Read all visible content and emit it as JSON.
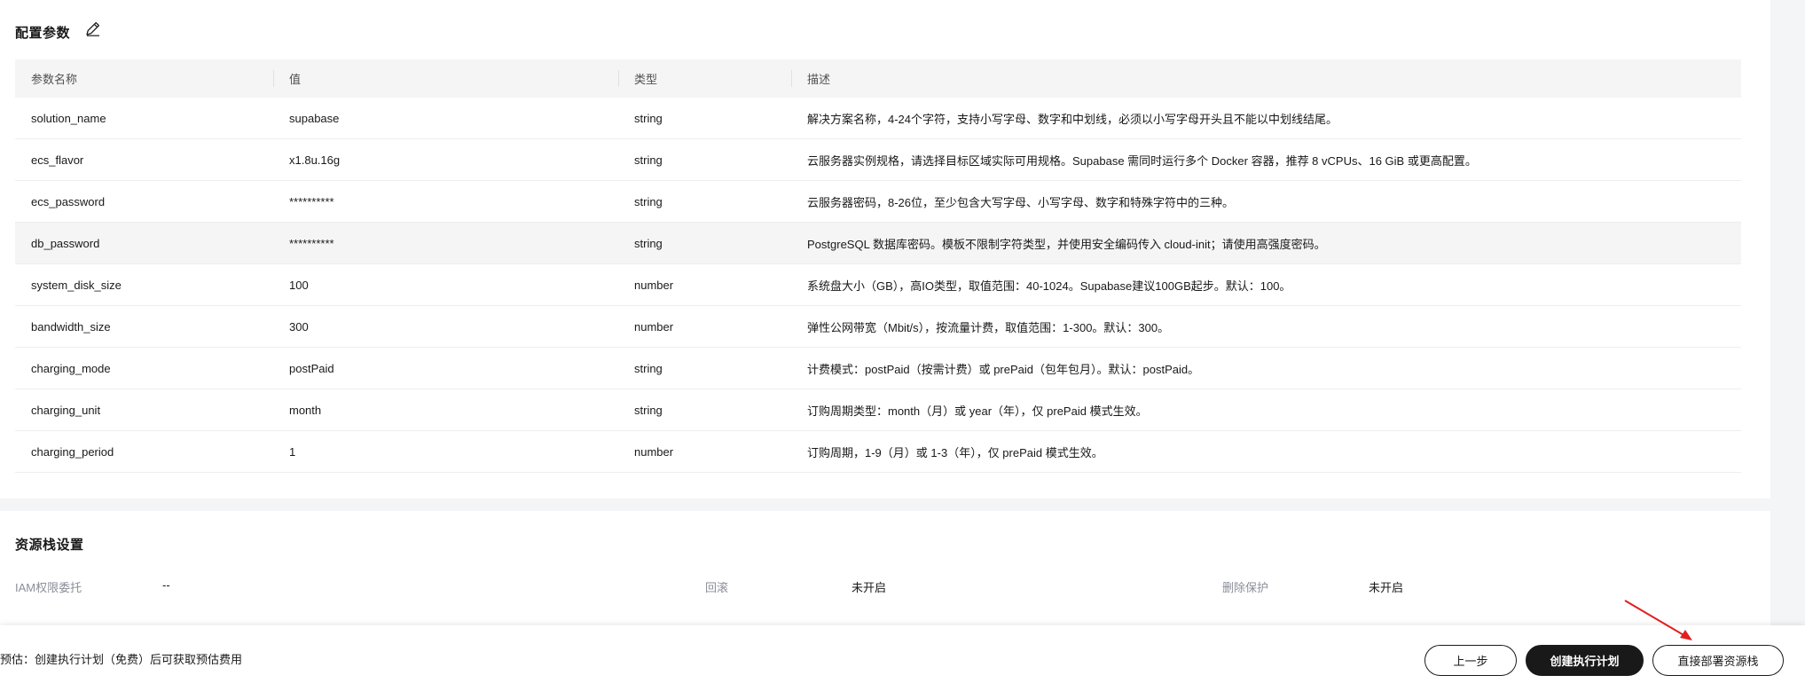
{
  "config": {
    "title": "配置参数",
    "edit_icon": "edit-pencil-icon",
    "columns": [
      "参数名称",
      "值",
      "类型",
      "描述"
    ],
    "rows": [
      {
        "name": "solution_name",
        "value": "supabase",
        "type": "string",
        "desc": "解决方案名称，4-24个字符，支持小写字母、数字和中划线，必须以小写字母开头且不能以中划线结尾。"
      },
      {
        "name": "ecs_flavor",
        "value": "x1.8u.16g",
        "type": "string",
        "desc": "云服务器实例规格，请选择目标区域实际可用规格。Supabase 需同时运行多个 Docker 容器，推荐 8 vCPUs、16 GiB 或更高配置。"
      },
      {
        "name": "ecs_password",
        "value": "**********",
        "type": "string",
        "desc": "云服务器密码，8-26位，至少包含大写字母、小写字母、数字和特殊字符中的三种。"
      },
      {
        "name": "db_password",
        "value": "**********",
        "type": "string",
        "desc": "PostgreSQL 数据库密码。模板不限制字符类型，并使用安全编码传入 cloud-init；请使用高强度密码。"
      },
      {
        "name": "system_disk_size",
        "value": "100",
        "type": "number",
        "desc": "系统盘大小（GB），高IO类型，取值范围：40-1024。Supabase建议100GB起步。默认：100。"
      },
      {
        "name": "bandwidth_size",
        "value": "300",
        "type": "number",
        "desc": "弹性公网带宽（Mbit/s），按流量计费，取值范围：1-300。默认：300。"
      },
      {
        "name": "charging_mode",
        "value": "postPaid",
        "type": "string",
        "desc": "计费模式：postPaid（按需计费）或 prePaid（包年包月）。默认：postPaid。"
      },
      {
        "name": "charging_unit",
        "value": "month",
        "type": "string",
        "desc": "订购周期类型：month（月）或 year（年），仅 prePaid 模式生效。"
      },
      {
        "name": "charging_period",
        "value": "1",
        "type": "number",
        "desc": "订购周期，1-9（月）或 1-3（年），仅 prePaid 模式生效。"
      }
    ]
  },
  "stack": {
    "title": "资源栈设置",
    "iam_label": "IAM权限委托",
    "iam_value": "--",
    "rollback_label": "回滚",
    "rollback_value": "未开启",
    "protect_label": "删除保护",
    "protect_value": "未开启"
  },
  "footer": {
    "fee_text": "预估：创建执行计划（免费）后可获取预估费用",
    "prev_label": "上一步",
    "plan_label": "创建执行计划",
    "deploy_label": "直接部署资源栈"
  },
  "colors": {
    "accent_dark": "#191919",
    "annotation_arrow": "#e02020",
    "header_bg": "#f5f5f6"
  }
}
